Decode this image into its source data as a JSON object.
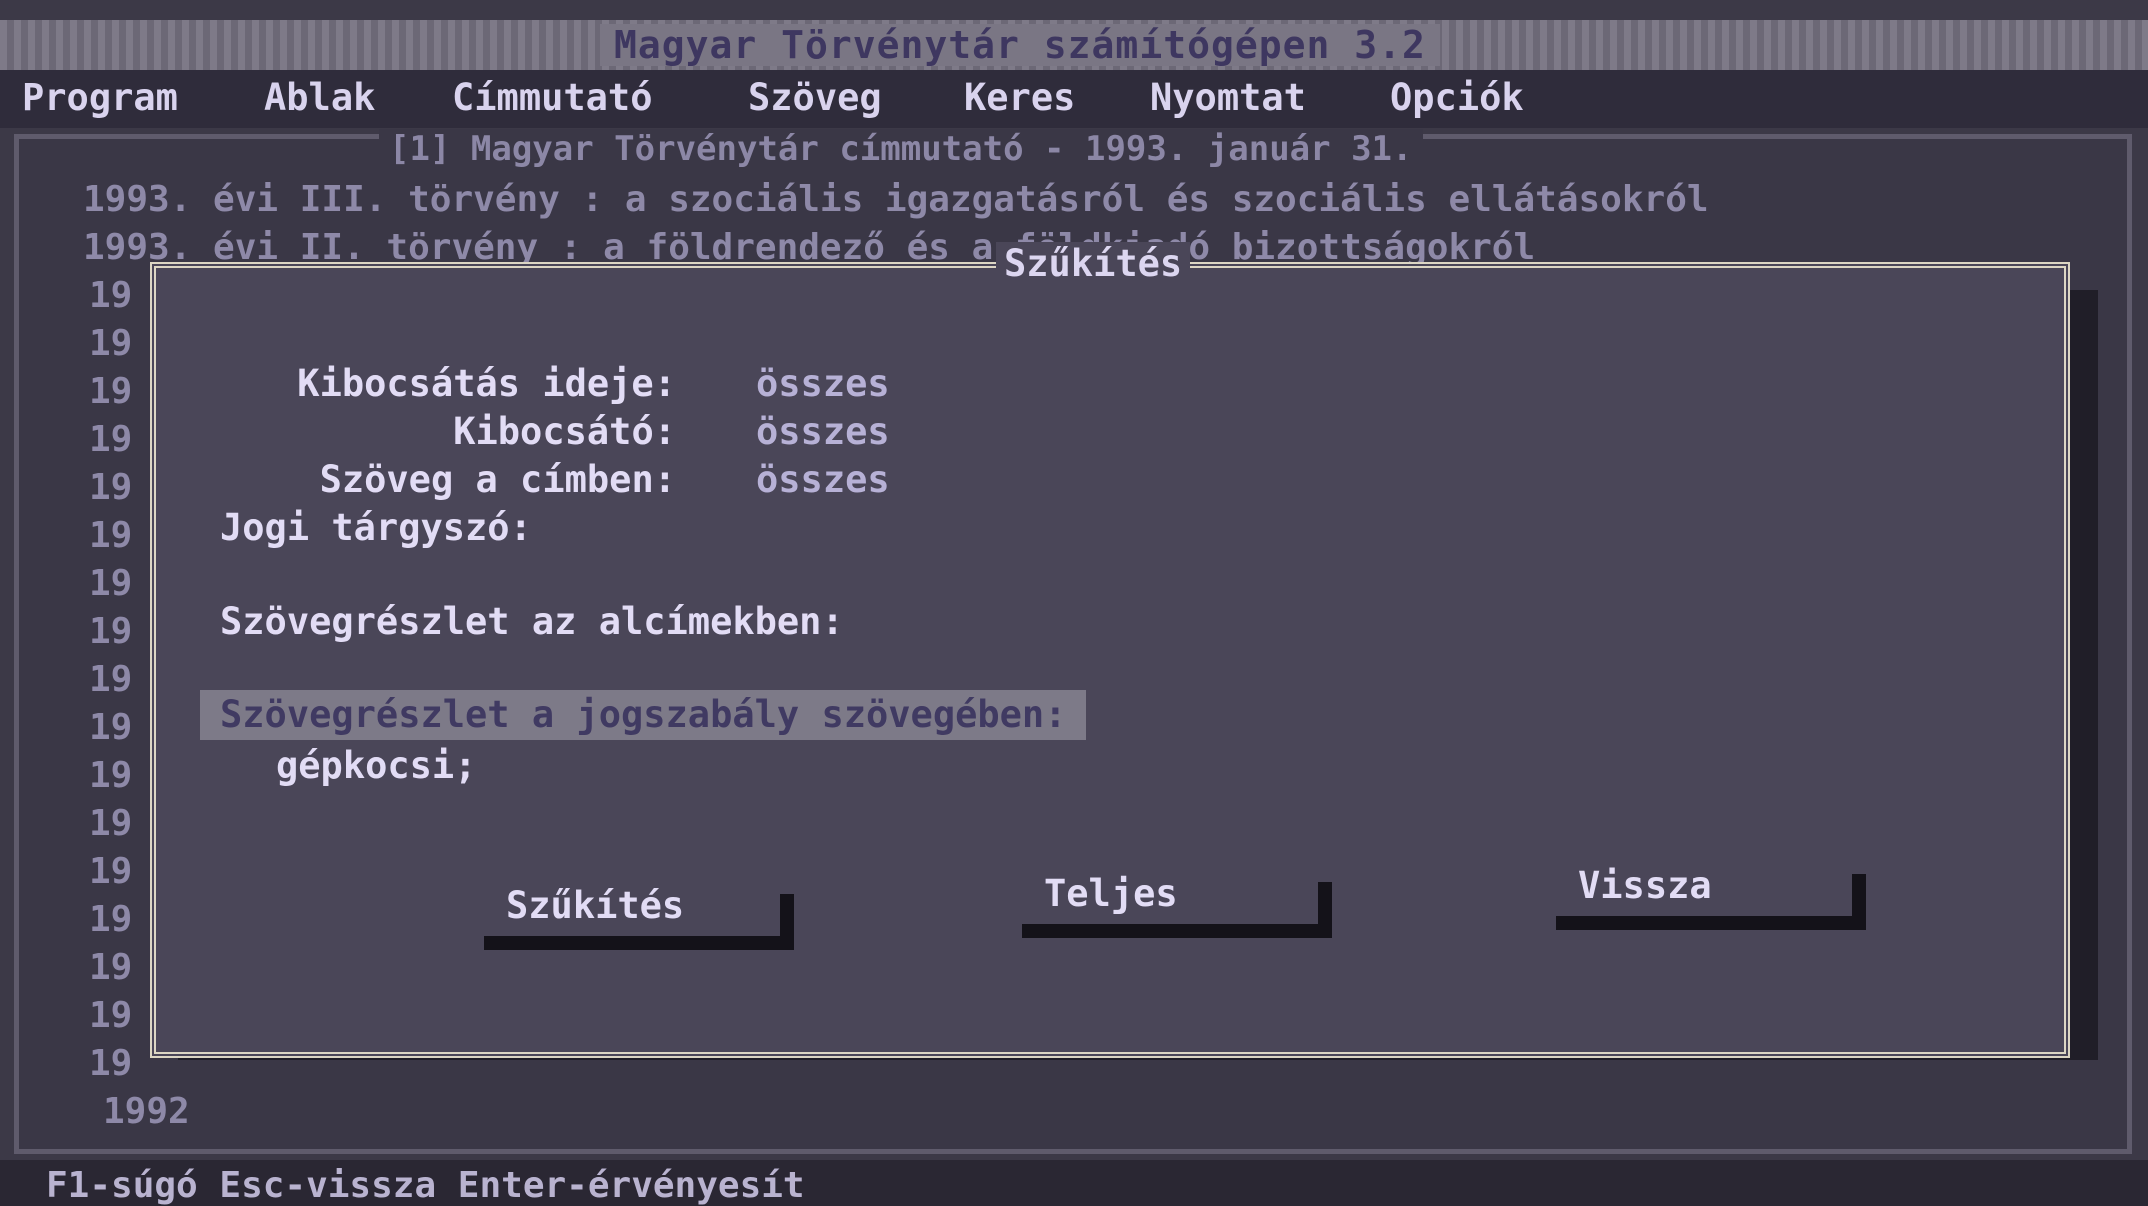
{
  "window_title": "Magyar Törvénytár számítógépen 3.2",
  "menu": [
    "Program",
    "Ablak",
    "Címmutató",
    "Szöveg",
    "Keres",
    "Nyomtat",
    "Opciók"
  ],
  "main": {
    "title": "[1] Magyar Törvénytár címmutató - 1993. január 31.",
    "rows": [
      "1993. évi III. törvény : a szociális igazgatásról és szociális ellátásokról",
      "1993. évi II. törvény : a földrendező és a földkiadó bizottságokról"
    ],
    "year_stubs": [
      "19",
      "19",
      "19",
      "19",
      "19",
      "19",
      "19",
      "19",
      "19",
      "19",
      "19",
      "19",
      "19",
      "19",
      "19",
      "19",
      "19"
    ],
    "last_row": "1992"
  },
  "dialog": {
    "title": "Szűkítés",
    "fields": [
      {
        "label": "Kibocsátás ideje:",
        "value": "összes"
      },
      {
        "label": "Kibocsátó:",
        "value": "összes"
      },
      {
        "label": "Szöveg a címben:",
        "value": "összes"
      }
    ],
    "jogi_targyszo_label": "Jogi tárgyszó:",
    "alcim_label": "Szövegrészlet az alcímekben:",
    "jogszabaly_label": "Szövegrészlet a jogszabály szövegében:",
    "jogszabaly_value": "gépkocsi;",
    "buttons": {
      "szukites": "Szűkítés",
      "teljes": "Teljes",
      "vissza": "Vissza"
    }
  },
  "status": "F1-súgó Esc-vissza Enter-érvényesít"
}
